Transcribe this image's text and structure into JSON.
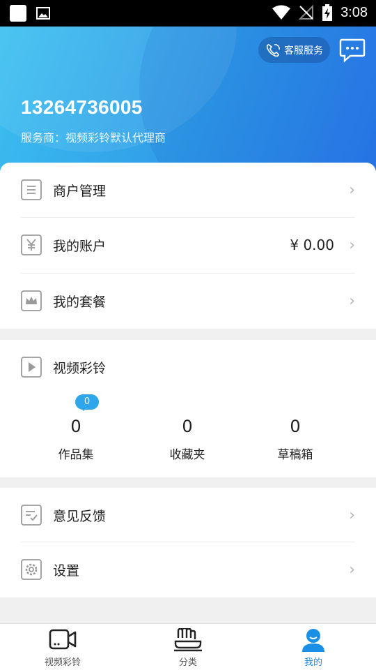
{
  "status_bar": {
    "time": "3:08"
  },
  "header": {
    "service_button": "客服服务",
    "phone_number": "13264736005",
    "provider_line": "服务商：视频彩铃默认代理商"
  },
  "menu_top": {
    "items": [
      {
        "label": "商户管理"
      },
      {
        "label": "我的账户",
        "value": "¥ 0.00"
      },
      {
        "label": "我的套餐"
      }
    ]
  },
  "video_ringtone": {
    "title": "视频彩铃",
    "badge": "0",
    "stats": [
      {
        "value": "0",
        "label": "作品集"
      },
      {
        "value": "0",
        "label": "收藏夹"
      },
      {
        "value": "0",
        "label": "草稿箱"
      }
    ]
  },
  "menu_bottom": {
    "items": [
      {
        "label": "意见反馈"
      },
      {
        "label": "设置"
      }
    ]
  },
  "tabbar": {
    "active_color": "#1a8fe6",
    "tabs": [
      {
        "label": "视频彩铃",
        "icon": "video-camera-icon"
      },
      {
        "label": "分类",
        "icon": "hand-category-icon"
      },
      {
        "label": "我的",
        "icon": "person-icon",
        "active": true
      }
    ]
  }
}
